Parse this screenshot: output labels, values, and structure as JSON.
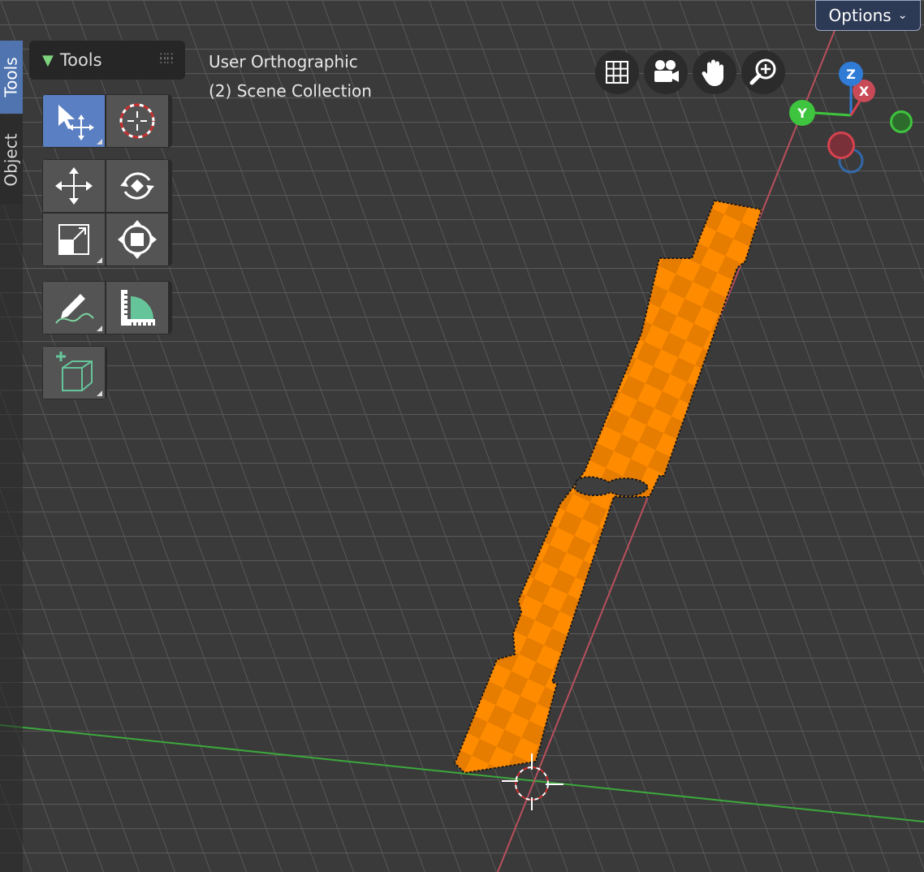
{
  "sidebar": {
    "tabs": [
      {
        "label": "Tools",
        "active": true
      },
      {
        "label": "Object",
        "active": false
      }
    ]
  },
  "tools_panel": {
    "title": "Tools",
    "tools": [
      {
        "name": "select-box",
        "icon": "cursor-move-icon",
        "active": true
      },
      {
        "name": "cursor",
        "icon": "3d-cursor-icon",
        "active": false
      },
      {
        "name": "move",
        "icon": "move-icon",
        "active": false
      },
      {
        "name": "rotate",
        "icon": "rotate-icon",
        "active": false
      },
      {
        "name": "scale",
        "icon": "scale-icon",
        "active": false
      },
      {
        "name": "transform",
        "icon": "transform-icon",
        "active": false
      },
      {
        "name": "annotate",
        "icon": "pencil-icon",
        "active": false
      },
      {
        "name": "measure",
        "icon": "ruler-icon",
        "active": false
      },
      {
        "name": "add-cube",
        "icon": "add-cube-icon",
        "active": false
      }
    ]
  },
  "viewport": {
    "view_name": "User Orthographic",
    "collection": "(2) Scene Collection"
  },
  "navigation": {
    "buttons": [
      {
        "name": "toggle-grid",
        "icon": "grid-icon"
      },
      {
        "name": "camera-view",
        "icon": "camera-icon"
      },
      {
        "name": "pan-view",
        "icon": "hand-icon"
      },
      {
        "name": "zoom-view",
        "icon": "zoom-in-icon"
      }
    ]
  },
  "header": {
    "options_label": "Options"
  },
  "gizmo": {
    "z_label": "Z",
    "x_label": "X",
    "y_label": "Y",
    "colors": {
      "x": "#d6424f",
      "y": "#3ec43e",
      "z": "#2f7bd6"
    }
  },
  "theme": {
    "accent": "#5a7fc2",
    "object_color": "#ff8c00",
    "grid": "#5a5a5a"
  }
}
